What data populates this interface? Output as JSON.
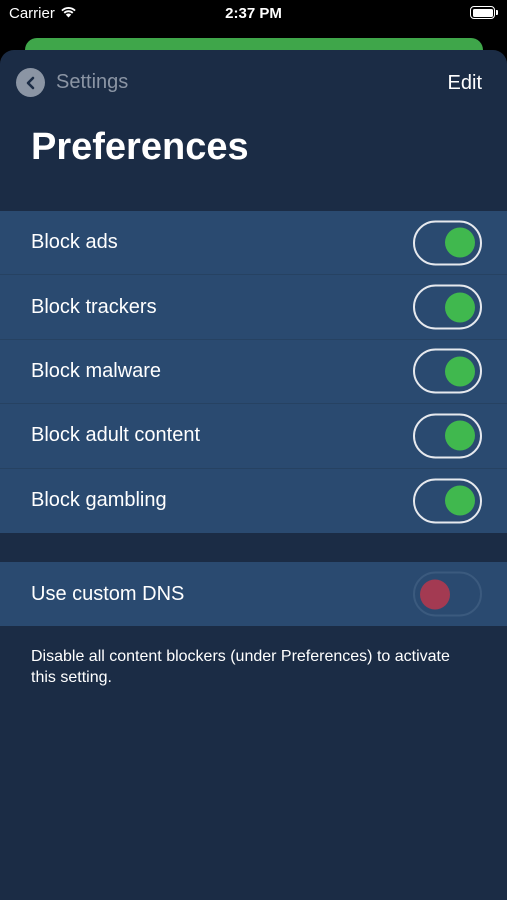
{
  "status_bar": {
    "carrier": "Carrier",
    "time": "2:37 PM"
  },
  "nav": {
    "back_label": "Settings",
    "edit_label": "Edit"
  },
  "title": "Preferences",
  "preferences": [
    {
      "label": "Block ads",
      "on": true
    },
    {
      "label": "Block trackers",
      "on": true
    },
    {
      "label": "Block malware",
      "on": true
    },
    {
      "label": "Block adult content",
      "on": true
    },
    {
      "label": "Block gambling",
      "on": true
    }
  ],
  "dns": {
    "label": "Use custom DNS",
    "on": false,
    "disabled": true
  },
  "footnote": "Disable all content blockers (under Preferences) to activate this setting.",
  "colors": {
    "sheet_bg": "#1b2c45",
    "row_bg": "#2a4a70",
    "toggle_on": "#40b84e",
    "toggle_disabled": "#a33a52",
    "banner": "#3fa64a"
  }
}
